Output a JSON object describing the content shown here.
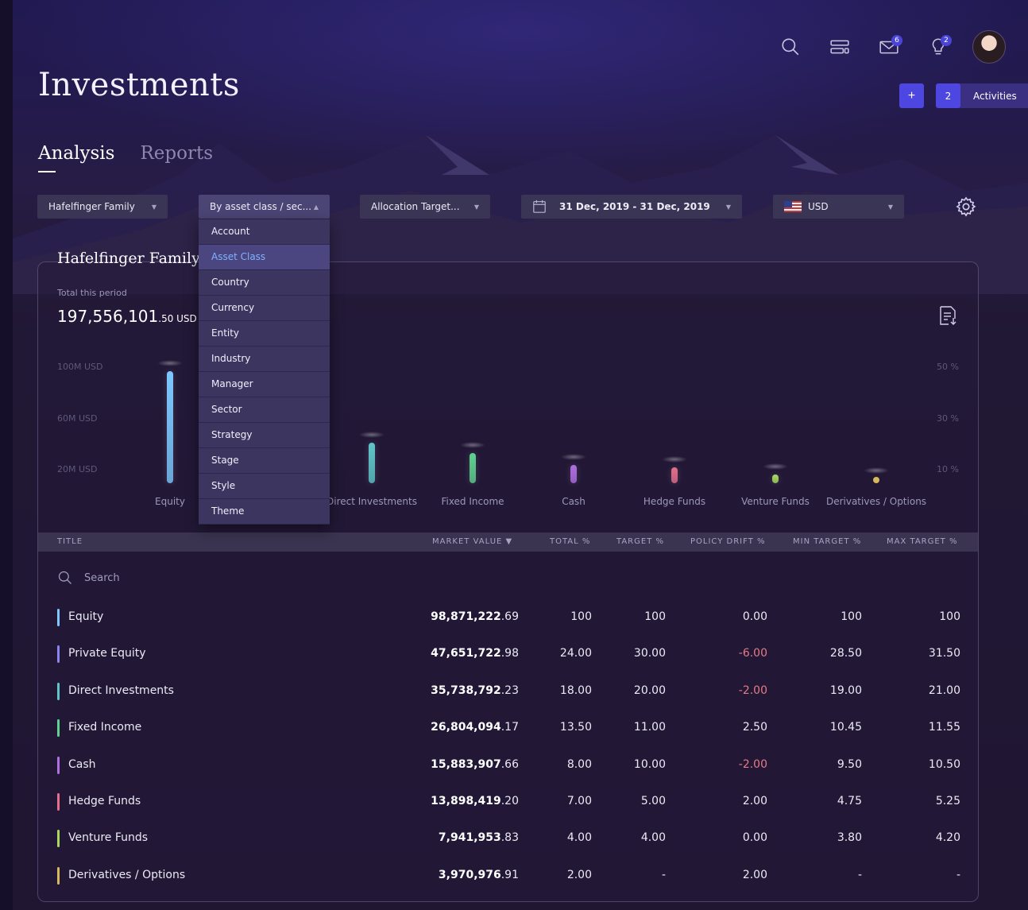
{
  "header": {
    "title": "Investments",
    "badges": {
      "mail": "6",
      "ideas": "2"
    },
    "add_label": "+",
    "activities_count": "2",
    "activities_label": "Activities"
  },
  "tabs": [
    {
      "label": "Analysis",
      "active": true
    },
    {
      "label": "Reports",
      "active": false
    }
  ],
  "filters": {
    "family": "Hafelfinger Family",
    "grouping": "By asset class / sec...",
    "allocation": "Allocation Target...",
    "date_range": "31 Dec, 2019 - 31 Dec, 2019",
    "currency": "USD"
  },
  "dropdown": {
    "items": [
      "Account",
      "Asset Class",
      "Country",
      "Currency",
      "Entity",
      "Industry",
      "Manager",
      "Sector",
      "Strategy",
      "Stage",
      "Style",
      "Theme"
    ],
    "selected": "Asset Class"
  },
  "summary": {
    "card_title": "Hafelfinger Family",
    "total_label": "Total this period",
    "total_main": "197,556,101",
    "total_cents": ".50 USD"
  },
  "chart_data": {
    "type": "bar",
    "categories": [
      "Equity",
      "Private Equity",
      "Direct Investments",
      "Fixed Income",
      "Cash",
      "Hedge Funds",
      "Venture Funds",
      "Derivatives / Options"
    ],
    "values": [
      98871222.69,
      47651722.98,
      35738792.23,
      26804094.17,
      15883907.66,
      13898419.2,
      7941953.83,
      3970976.91
    ],
    "left_axis_ticks": [
      "100M USD",
      "60M USD",
      "20M USD"
    ],
    "right_axis_ticks": [
      "50 %",
      "30 %",
      "10 %"
    ],
    "ylim": [
      0,
      100000000
    ],
    "colors": [
      "#7cc8ff",
      "#8a84ee",
      "#5fc6c8",
      "#5fd28f",
      "#b06fe0",
      "#e46f8a",
      "#a8d95e",
      "#d7b85c"
    ]
  },
  "table": {
    "headers": [
      "TITLE",
      "MARKET VALUE ▼",
      "TOTAL %",
      "TARGET %",
      "POLICY DRIFT %",
      "MIN TARGET %",
      "MAX TARGET %"
    ],
    "search_placeholder": "Search",
    "rows": [
      {
        "name": "Equity",
        "mv_main": "98,871,222",
        "mv_cents": ".69",
        "total": "100",
        "target": "100",
        "drift": "0.00",
        "min": "100",
        "max": "100",
        "color": "#7cc8ff"
      },
      {
        "name": "Private Equity",
        "mv_main": "47,651,722",
        "mv_cents": ".98",
        "total": "24.00",
        "target": "30.00",
        "drift": "-6.00",
        "min": "28.50",
        "max": "31.50",
        "color": "#8a84ee"
      },
      {
        "name": "Direct Investments",
        "mv_main": "35,738,792",
        "mv_cents": ".23",
        "total": "18.00",
        "target": "20.00",
        "drift": "-2.00",
        "min": "19.00",
        "max": "21.00",
        "color": "#5fc6c8"
      },
      {
        "name": "Fixed Income",
        "mv_main": "26,804,094",
        "mv_cents": ".17",
        "total": "13.50",
        "target": "11.00",
        "drift": "2.50",
        "min": "10.45",
        "max": "11.55",
        "color": "#5fd28f"
      },
      {
        "name": "Cash",
        "mv_main": "15,883,907",
        "mv_cents": ".66",
        "total": "8.00",
        "target": "10.00",
        "drift": "-2.00",
        "min": "9.50",
        "max": "10.50",
        "color": "#b06fe0"
      },
      {
        "name": "Hedge Funds",
        "mv_main": "13,898,419",
        "mv_cents": ".20",
        "total": "7.00",
        "target": "5.00",
        "drift": "2.00",
        "min": "4.75",
        "max": "5.25",
        "color": "#e46f8a"
      },
      {
        "name": "Venture Funds",
        "mv_main": "7,941,953",
        "mv_cents": ".83",
        "total": "4.00",
        "target": "4.00",
        "drift": "0.00",
        "min": "3.80",
        "max": "4.20",
        "color": "#a8d95e"
      },
      {
        "name": "Derivatives / Options",
        "mv_main": "3,970,976",
        "mv_cents": ".91",
        "total": "2.00",
        "target": "-",
        "drift": "2.00",
        "min": "-",
        "max": "-",
        "color": "#d7b85c"
      }
    ]
  }
}
